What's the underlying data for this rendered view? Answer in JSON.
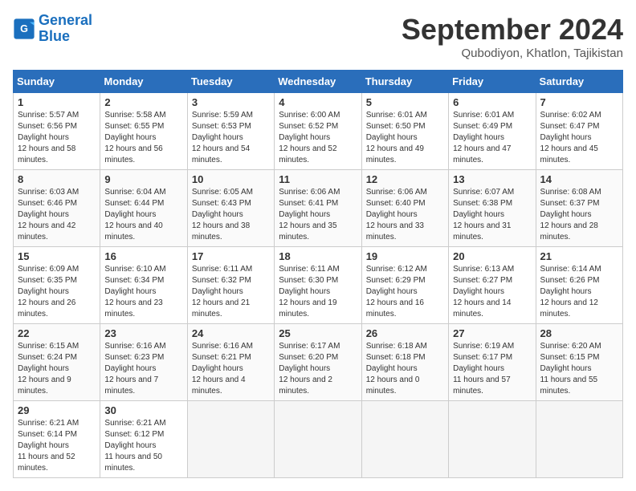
{
  "header": {
    "logo_line1": "General",
    "logo_line2": "Blue",
    "month_title": "September 2024",
    "location": "Qubodiyon, Khatlon, Tajikistan"
  },
  "days_of_week": [
    "Sunday",
    "Monday",
    "Tuesday",
    "Wednesday",
    "Thursday",
    "Friday",
    "Saturday"
  ],
  "weeks": [
    [
      {
        "day": "1",
        "sunrise": "5:57 AM",
        "sunset": "6:56 PM",
        "daylight": "12 hours and 58 minutes."
      },
      {
        "day": "2",
        "sunrise": "5:58 AM",
        "sunset": "6:55 PM",
        "daylight": "12 hours and 56 minutes."
      },
      {
        "day": "3",
        "sunrise": "5:59 AM",
        "sunset": "6:53 PM",
        "daylight": "12 hours and 54 minutes."
      },
      {
        "day": "4",
        "sunrise": "6:00 AM",
        "sunset": "6:52 PM",
        "daylight": "12 hours and 52 minutes."
      },
      {
        "day": "5",
        "sunrise": "6:01 AM",
        "sunset": "6:50 PM",
        "daylight": "12 hours and 49 minutes."
      },
      {
        "day": "6",
        "sunrise": "6:01 AM",
        "sunset": "6:49 PM",
        "daylight": "12 hours and 47 minutes."
      },
      {
        "day": "7",
        "sunrise": "6:02 AM",
        "sunset": "6:47 PM",
        "daylight": "12 hours and 45 minutes."
      }
    ],
    [
      {
        "day": "8",
        "sunrise": "6:03 AM",
        "sunset": "6:46 PM",
        "daylight": "12 hours and 42 minutes."
      },
      {
        "day": "9",
        "sunrise": "6:04 AM",
        "sunset": "6:44 PM",
        "daylight": "12 hours and 40 minutes."
      },
      {
        "day": "10",
        "sunrise": "6:05 AM",
        "sunset": "6:43 PM",
        "daylight": "12 hours and 38 minutes."
      },
      {
        "day": "11",
        "sunrise": "6:06 AM",
        "sunset": "6:41 PM",
        "daylight": "12 hours and 35 minutes."
      },
      {
        "day": "12",
        "sunrise": "6:06 AM",
        "sunset": "6:40 PM",
        "daylight": "12 hours and 33 minutes."
      },
      {
        "day": "13",
        "sunrise": "6:07 AM",
        "sunset": "6:38 PM",
        "daylight": "12 hours and 31 minutes."
      },
      {
        "day": "14",
        "sunrise": "6:08 AM",
        "sunset": "6:37 PM",
        "daylight": "12 hours and 28 minutes."
      }
    ],
    [
      {
        "day": "15",
        "sunrise": "6:09 AM",
        "sunset": "6:35 PM",
        "daylight": "12 hours and 26 minutes."
      },
      {
        "day": "16",
        "sunrise": "6:10 AM",
        "sunset": "6:34 PM",
        "daylight": "12 hours and 23 minutes."
      },
      {
        "day": "17",
        "sunrise": "6:11 AM",
        "sunset": "6:32 PM",
        "daylight": "12 hours and 21 minutes."
      },
      {
        "day": "18",
        "sunrise": "6:11 AM",
        "sunset": "6:30 PM",
        "daylight": "12 hours and 19 minutes."
      },
      {
        "day": "19",
        "sunrise": "6:12 AM",
        "sunset": "6:29 PM",
        "daylight": "12 hours and 16 minutes."
      },
      {
        "day": "20",
        "sunrise": "6:13 AM",
        "sunset": "6:27 PM",
        "daylight": "12 hours and 14 minutes."
      },
      {
        "day": "21",
        "sunrise": "6:14 AM",
        "sunset": "6:26 PM",
        "daylight": "12 hours and 12 minutes."
      }
    ],
    [
      {
        "day": "22",
        "sunrise": "6:15 AM",
        "sunset": "6:24 PM",
        "daylight": "12 hours and 9 minutes."
      },
      {
        "day": "23",
        "sunrise": "6:16 AM",
        "sunset": "6:23 PM",
        "daylight": "12 hours and 7 minutes."
      },
      {
        "day": "24",
        "sunrise": "6:16 AM",
        "sunset": "6:21 PM",
        "daylight": "12 hours and 4 minutes."
      },
      {
        "day": "25",
        "sunrise": "6:17 AM",
        "sunset": "6:20 PM",
        "daylight": "12 hours and 2 minutes."
      },
      {
        "day": "26",
        "sunrise": "6:18 AM",
        "sunset": "6:18 PM",
        "daylight": "12 hours and 0 minutes."
      },
      {
        "day": "27",
        "sunrise": "6:19 AM",
        "sunset": "6:17 PM",
        "daylight": "11 hours and 57 minutes."
      },
      {
        "day": "28",
        "sunrise": "6:20 AM",
        "sunset": "6:15 PM",
        "daylight": "11 hours and 55 minutes."
      }
    ],
    [
      {
        "day": "29",
        "sunrise": "6:21 AM",
        "sunset": "6:14 PM",
        "daylight": "11 hours and 52 minutes."
      },
      {
        "day": "30",
        "sunrise": "6:21 AM",
        "sunset": "6:12 PM",
        "daylight": "11 hours and 50 minutes."
      },
      null,
      null,
      null,
      null,
      null
    ]
  ]
}
